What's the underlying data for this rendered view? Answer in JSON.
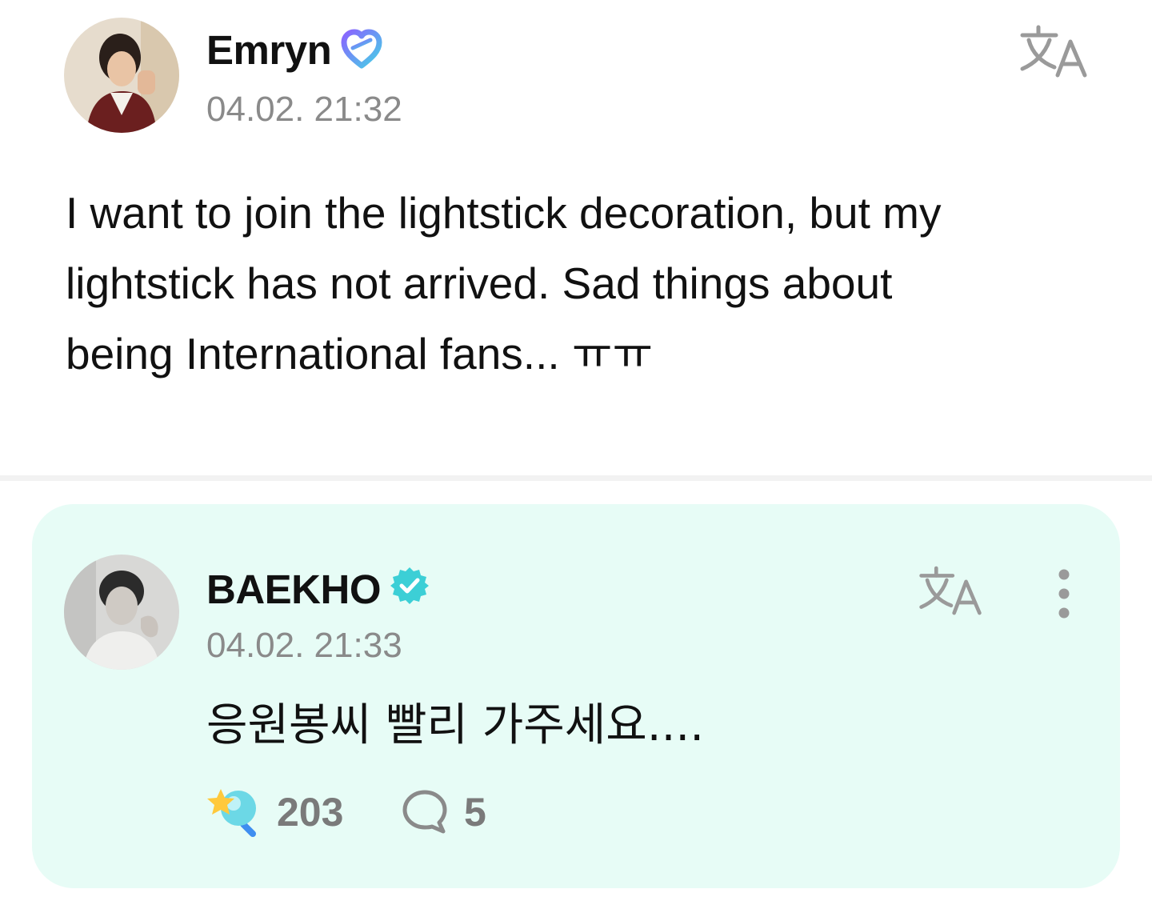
{
  "post": {
    "author": "Emryn",
    "timestamp": "04.02. 21:32",
    "body": "I want to join the lightstick decoration, but my\nlightstick has not arrived. Sad things about\nbeing International fans... ㅠㅠ",
    "badge_icon": "fan-heart-badge-icon",
    "translate_icon": "translate-icon"
  },
  "comment": {
    "author": "BAEKHO",
    "timestamp": "04.02. 21:33",
    "body": "응원봉씨 빨리 가주세요....",
    "badge_icon": "verified-badge-icon",
    "translate_icon": "translate-icon",
    "more_icon": "more-vertical-icon",
    "likes": "203",
    "replies": "5",
    "like_icon": "cheer-lightstick-icon",
    "reply_icon": "speech-bubble-icon"
  },
  "colors": {
    "card_background": "#e7fcf6",
    "verified_badge": "#3ccfd6",
    "fan_badge_start": "#8a63ff",
    "fan_badge_end": "#45d1e6",
    "secondary_text": "#8a8a8a",
    "icon_gray": "#9a9a9a"
  }
}
